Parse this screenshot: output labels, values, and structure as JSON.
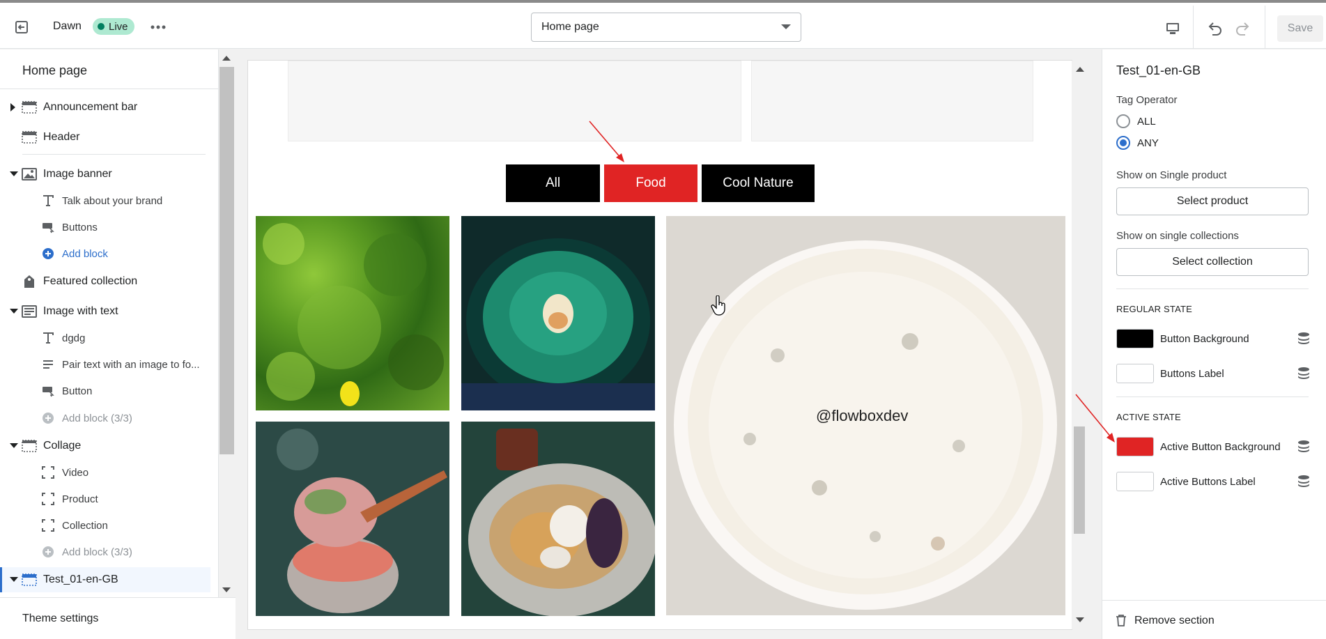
{
  "topbar": {
    "theme_name": "Dawn",
    "live_badge": "Live",
    "page_select": "Home page",
    "save_label": "Save"
  },
  "left_panel": {
    "title": "Home page",
    "items": [
      {
        "label": "Announcement bar"
      },
      {
        "label": "Header"
      },
      {
        "label": "Image banner"
      },
      {
        "label": "Talk about your brand"
      },
      {
        "label": "Buttons"
      },
      {
        "label": "Add block"
      },
      {
        "label": "Featured collection"
      },
      {
        "label": "Image with text"
      },
      {
        "label": "dgdg"
      },
      {
        "label": "Pair text with an image to fo..."
      },
      {
        "label": "Button"
      },
      {
        "label": "Add block (3/3)"
      },
      {
        "label": "Collage"
      },
      {
        "label": "Video"
      },
      {
        "label": "Product"
      },
      {
        "label": "Collection"
      },
      {
        "label": "Add block (3/3)"
      },
      {
        "label": "Test_01-en-GB"
      }
    ],
    "theme_settings": "Theme settings"
  },
  "preview": {
    "tabs": [
      {
        "label": "All",
        "color": "#000000"
      },
      {
        "label": "Food",
        "color": "#e02424"
      },
      {
        "label": "Cool Nature",
        "color": "#000000"
      }
    ],
    "overlay_handle": "@flowboxdev"
  },
  "right_panel": {
    "title": "Test_01-en-GB",
    "tag_operator_label": "Tag Operator",
    "radio_all": "ALL",
    "radio_any": "ANY",
    "single_product_label": "Show on Single product",
    "select_product": "Select product",
    "single_collections_label": "Show on single collections",
    "select_collection": "Select collection",
    "regular_state": "REGULAR STATE",
    "button_background": "Button Background",
    "buttons_label": "Buttons Label",
    "active_state": "ACTIVE STATE",
    "active_button_background": "Active Button Background",
    "active_buttons_label": "Active Buttons Label",
    "remove_section": "Remove section",
    "colors": {
      "button_background": "#000000",
      "buttons_label": "#ffffff",
      "active_button_background": "#e02424",
      "active_buttons_label": "#ffffff"
    }
  }
}
